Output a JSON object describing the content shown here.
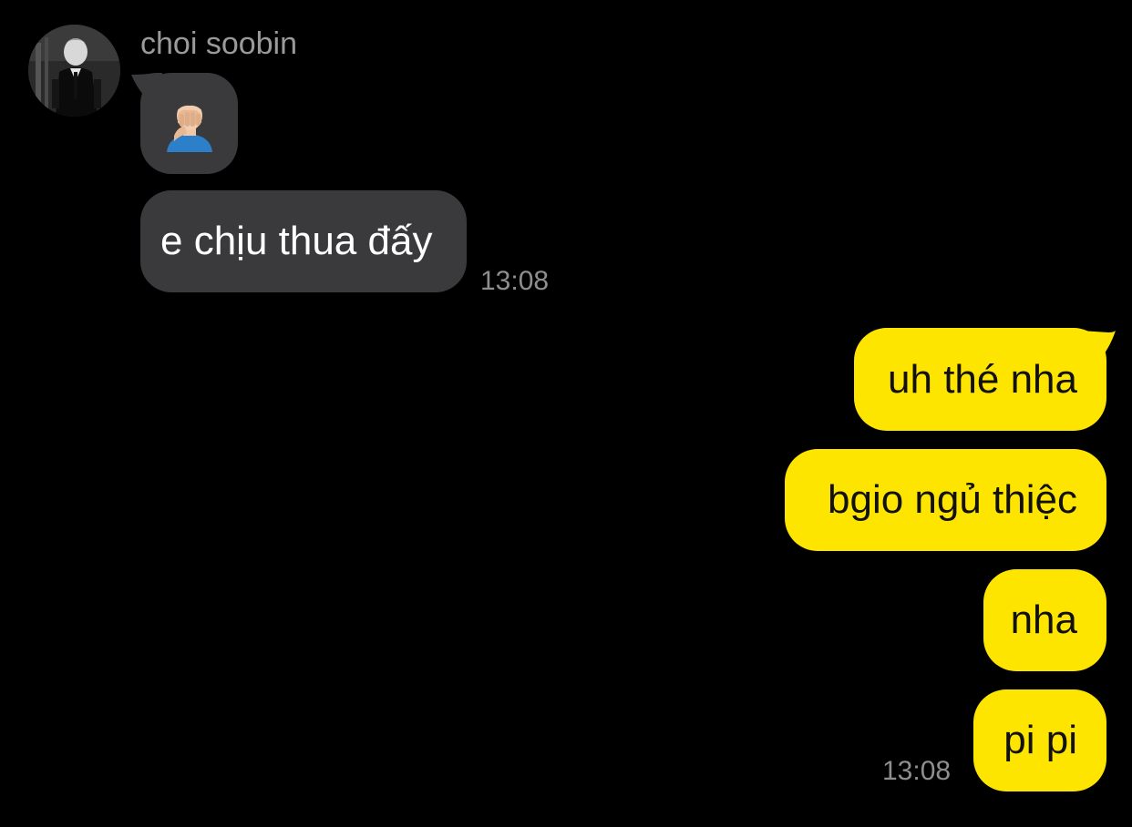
{
  "chat": {
    "sender": {
      "name": "choi soobin",
      "avatar_icon": "profile-photo"
    },
    "incoming": {
      "emoji_icon": "man-facepalming-emoji",
      "text": "e chịu thua đấy",
      "time": "13:08"
    },
    "outgoing": {
      "messages": [
        "uh thé nha",
        "bgio ngủ thiệc",
        "nha",
        "pi pi"
      ],
      "time": "13:08"
    },
    "colors": {
      "background": "#000000",
      "incoming_bubble": "#3a3a3c",
      "outgoing_bubble": "#fee500",
      "timestamp": "#8e8e8e"
    }
  }
}
